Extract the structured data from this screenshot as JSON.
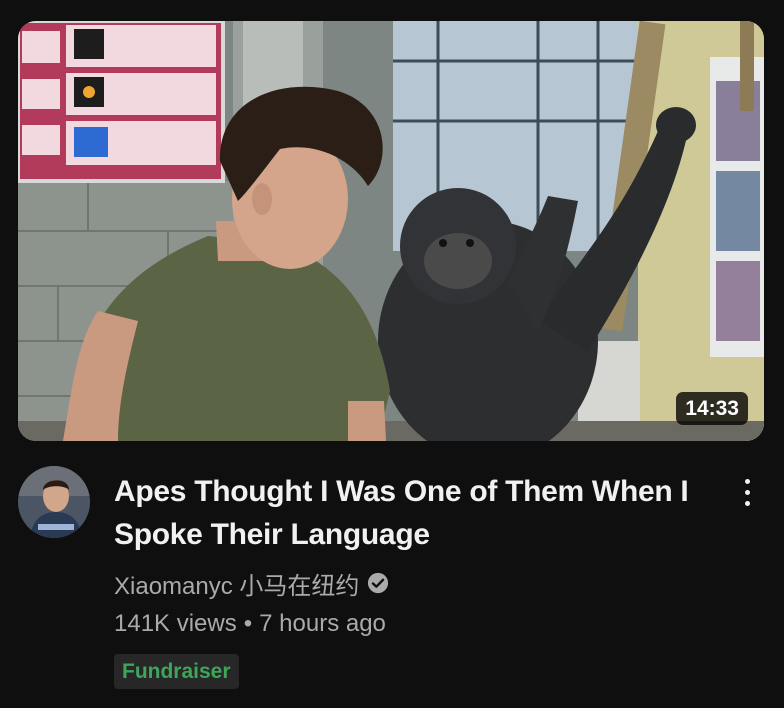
{
  "video": {
    "title": "Apes Thought I Was One of Them When I Spoke Their Language",
    "duration": "14:33",
    "channel": "Xiaomanyc 小马在纽约",
    "views": "141K views",
    "age": "7 hours ago",
    "separator": "•",
    "badge": "Fundraiser",
    "verified": true
  },
  "icons": {
    "verified": "verified-check-icon",
    "menu": "more-vert-icon"
  },
  "colors": {
    "background": "#0f0f0f",
    "title": "#f1f1f1",
    "secondary_text": "#aaaaaa",
    "badge_bg": "#272727",
    "badge_text": "#3ea55a"
  }
}
